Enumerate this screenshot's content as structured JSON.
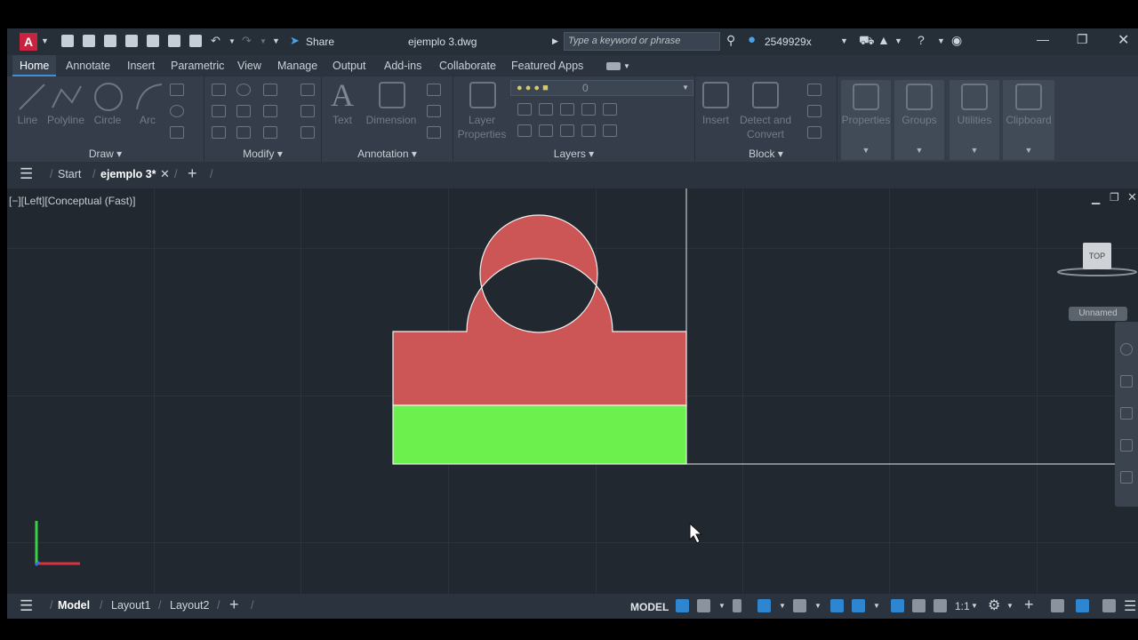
{
  "app": {
    "logo_letter": "A",
    "title": "ejemplo 3.dwg",
    "share_label": "Share",
    "user": "2549929x"
  },
  "search": {
    "placeholder": "Type a keyword or phrase"
  },
  "ribbon_tabs": [
    "Home",
    "Annotate",
    "Insert",
    "Parametric",
    "View",
    "Manage",
    "Output",
    "Add-ins",
    "Collaborate",
    "Featured Apps"
  ],
  "panels": {
    "draw": {
      "title": "Draw",
      "buttons": [
        "Line",
        "Polyline",
        "Circle",
        "Arc"
      ]
    },
    "modify": {
      "title": "Modify"
    },
    "annotation": {
      "title": "Annotation",
      "buttons": [
        "Text",
        "Dimension"
      ]
    },
    "layers": {
      "title": "Layers",
      "layer_props_1": "Layer",
      "layer_props_2": "Properties",
      "current_layer": "0"
    },
    "block": {
      "title": "Block",
      "insert": "Insert",
      "detect_1": "Detect and",
      "detect_2": "Convert"
    },
    "others": [
      "Properties",
      "Groups",
      "Utilities",
      "Clipboard"
    ]
  },
  "doc_tabs": {
    "start": "Start",
    "active": "ejemplo 3*"
  },
  "viewport": {
    "label": "[−][Left][Conceptual (Fast)]",
    "viewcube": "TOP",
    "named_view": "Unnamed"
  },
  "colors": {
    "red_part": "#cc5555",
    "green_part": "#6cf04d",
    "accent": "#2f86d0"
  },
  "status": {
    "tabs": [
      "Model",
      "Layout1",
      "Layout2"
    ],
    "model_label": "MODEL",
    "scale": "1:1"
  },
  "icons": [
    "menu-icon",
    "plus-icon",
    "close-icon",
    "search-icon",
    "user-icon",
    "cart-icon",
    "help-icon",
    "gear-icon",
    "cursor-icon",
    "ucs-icon"
  ]
}
